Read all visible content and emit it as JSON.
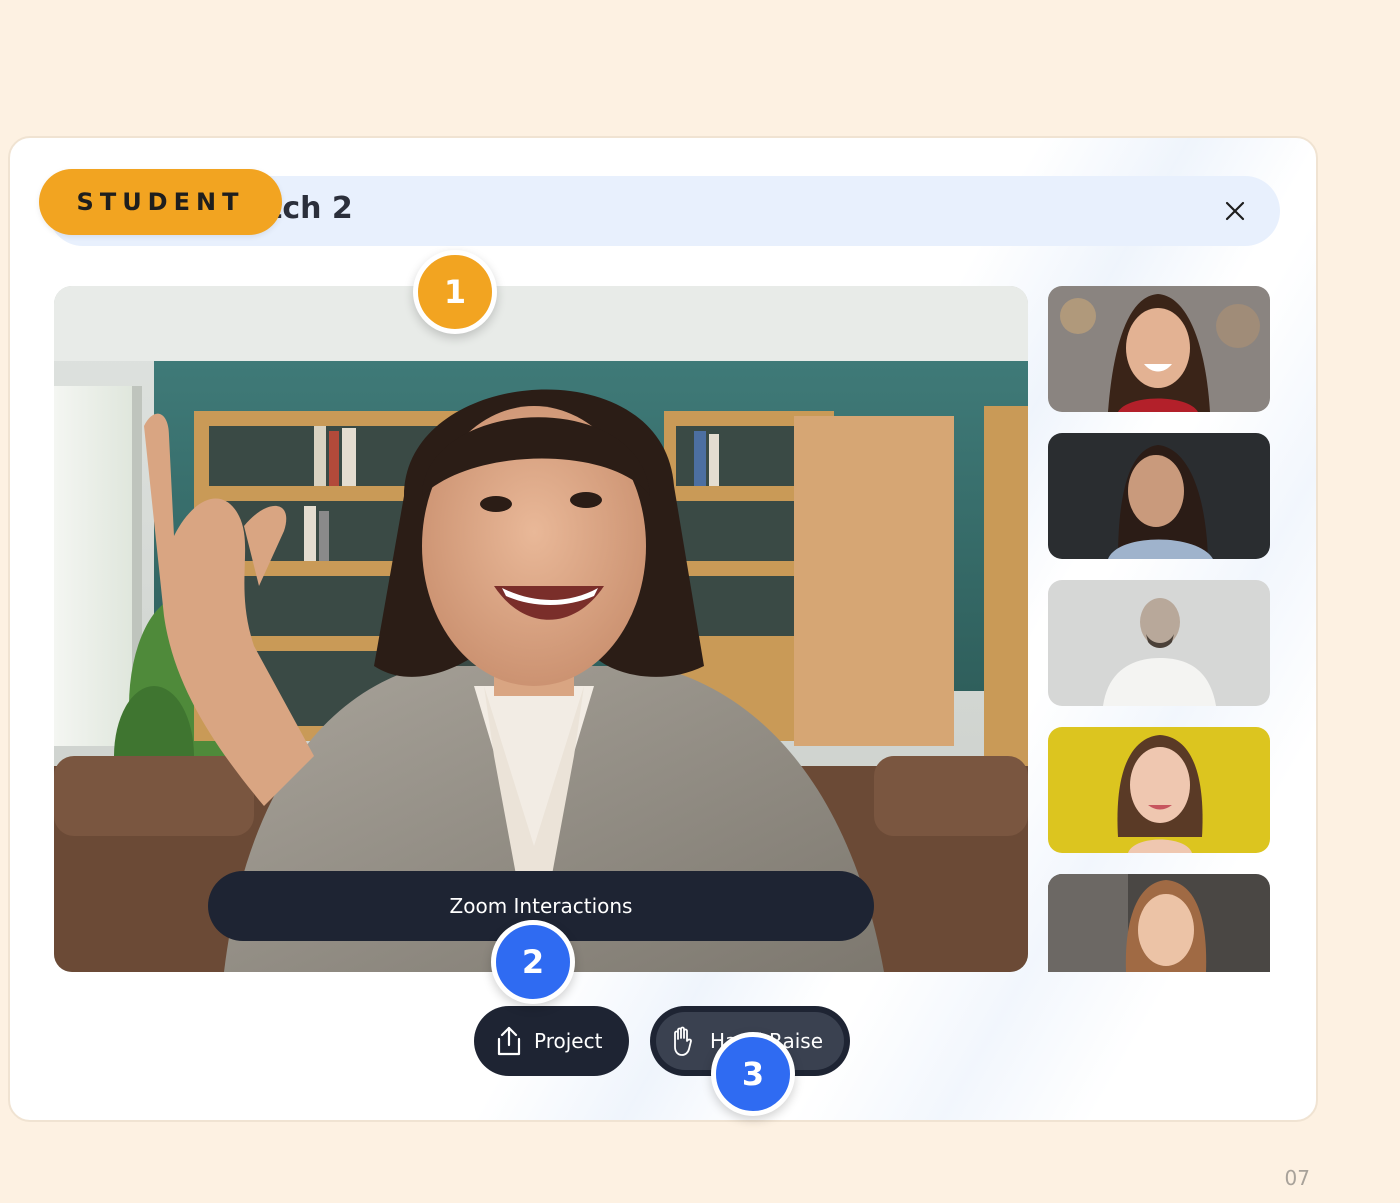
{
  "dialog": {
    "title": "Batch 2",
    "title_visible": "tch 2",
    "close_icon": "close-icon"
  },
  "badge": {
    "label": "STUDENT",
    "color": "#f2a421"
  },
  "main_video": {
    "overlay_label": "Zoom Interactions"
  },
  "participants": [
    {
      "name": "participant-1"
    },
    {
      "name": "participant-2"
    },
    {
      "name": "participant-3"
    },
    {
      "name": "participant-4"
    },
    {
      "name": "participant-5"
    }
  ],
  "controls": {
    "project_label": "Project",
    "project_icon": "share-upload-icon",
    "hand_raise_label": "Hand Raise",
    "hand_raise_icon": "hand-icon"
  },
  "markers": {
    "one": "1",
    "two": "2",
    "three": "3"
  },
  "colors": {
    "background": "#fdf1e2",
    "accent_orange": "#f2a421",
    "accent_blue": "#2f6bf2",
    "dark_control": "#1e2433",
    "title_bar": "#e8f0fd"
  },
  "page_number": "07"
}
